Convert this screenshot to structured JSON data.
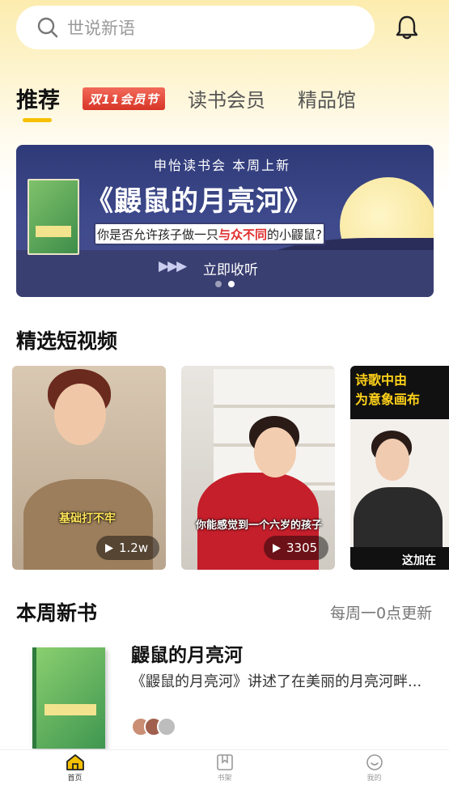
{
  "search": {
    "placeholder": "世说新语"
  },
  "tabs": [
    {
      "label": "推荐",
      "active": true
    },
    {
      "label": "双11会员节",
      "badge": true
    },
    {
      "label": "读书会员"
    },
    {
      "label": "精品馆"
    }
  ],
  "banner": {
    "subtitle": "申怡读书会 本周上新",
    "title": "《鼹鼠的月亮河》",
    "question_pre": "你是否允许孩子做一只",
    "question_highlight": "与众不同",
    "question_post": "的小鼹鼠?",
    "cta": "立即收听",
    "cta_arrows": "▶▶▶",
    "page_count": 2,
    "current_page": 2
  },
  "short_videos": {
    "title": "精选短视频",
    "items": [
      {
        "caption": "基础打不牢",
        "plays": "1.2w"
      },
      {
        "caption": "你能感觉到一个六岁的孩子",
        "plays": "3305"
      },
      {
        "caption_top": "诗歌中由\n为意象画布",
        "caption": "这加在"
      }
    ]
  },
  "new_books": {
    "title": "本周新书",
    "more": "每周一0点更新",
    "book": {
      "title": "鼹鼠的月亮河",
      "desc": "《鼹鼠的月亮河》讲述了在美丽的月亮河畔..."
    }
  },
  "bottom_nav": [
    {
      "label": "首页",
      "icon": "home-icon",
      "active": true
    },
    {
      "label": "书架",
      "icon": "bookshelf-icon"
    },
    {
      "label": "我的",
      "icon": "profile-icon"
    }
  ],
  "colors": {
    "accent": "#f5c000",
    "badge": "#d73526",
    "banner": "#3e4a8c"
  }
}
